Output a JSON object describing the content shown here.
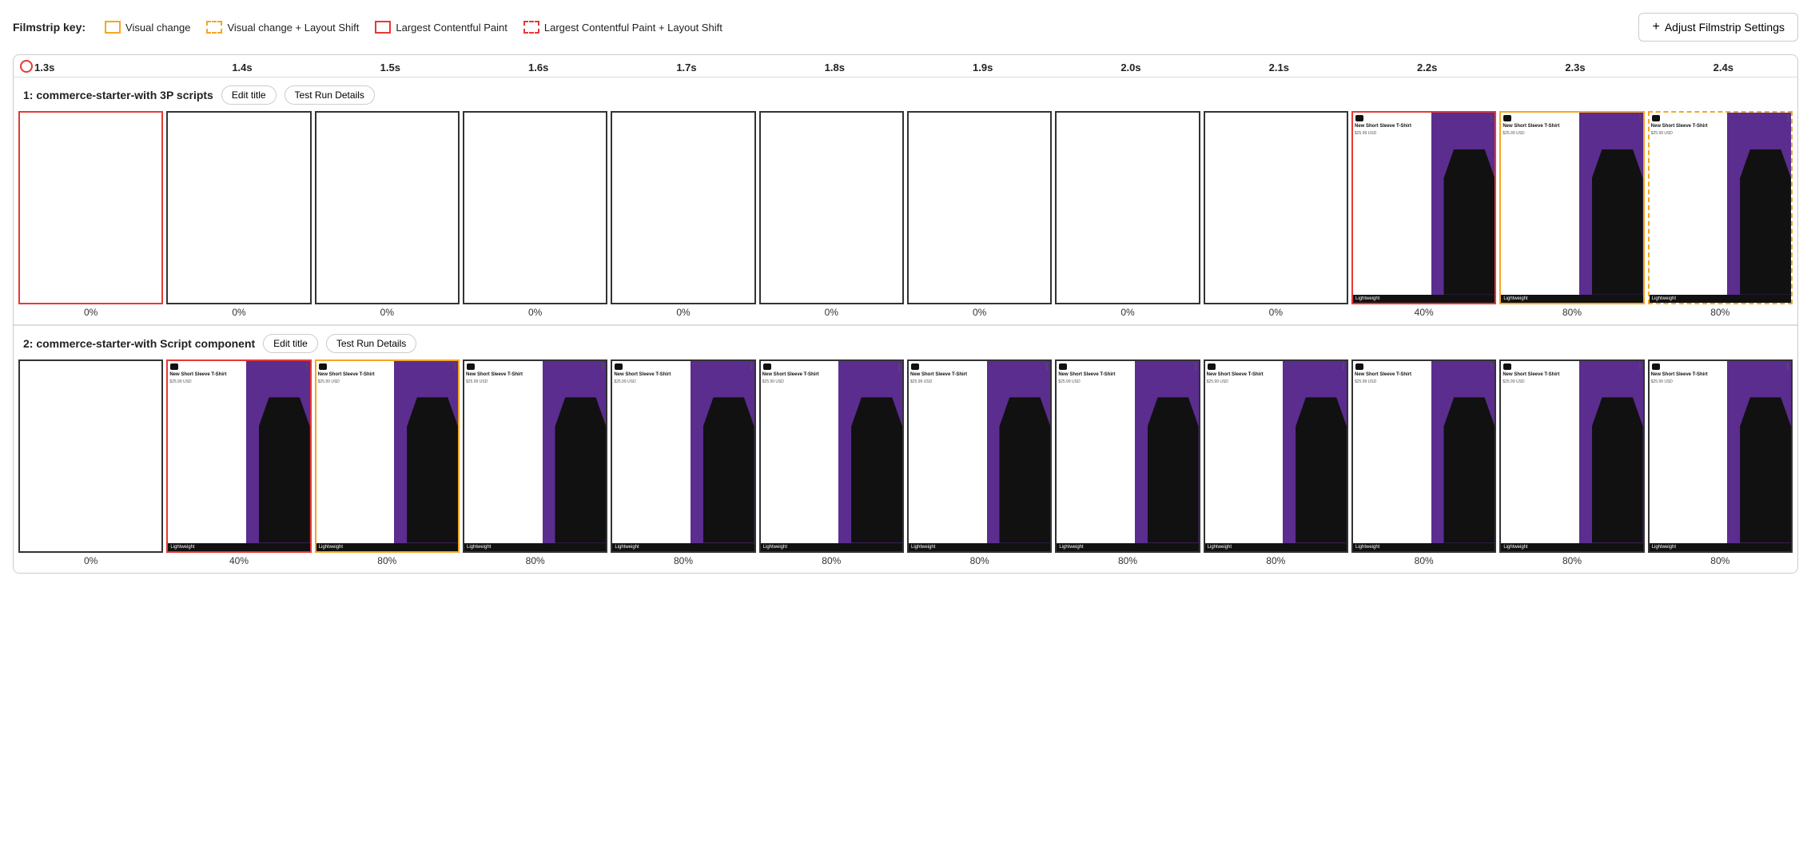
{
  "legend": {
    "label": "Filmstrip key:",
    "items": [
      {
        "id": "visual-change",
        "box_style": "solid-yellow",
        "label": "Visual change"
      },
      {
        "id": "visual-change-layout-shift",
        "box_style": "dashed-yellow",
        "label": "Visual change + Layout Shift"
      },
      {
        "id": "lcp",
        "box_style": "solid-red",
        "label": "Largest Contentful Paint"
      },
      {
        "id": "lcp-layout-shift",
        "box_style": "dashed-red",
        "label": "Largest Contentful Paint + Layout Shift"
      }
    ]
  },
  "adjust_button": {
    "label": "Adjust Filmstrip Settings",
    "icon": "+"
  },
  "timeline_ticks": [
    "1.3s",
    "1.4s",
    "1.5s",
    "1.6s",
    "1.7s",
    "1.8s",
    "1.9s",
    "2.0s",
    "2.1s",
    "2.2s",
    "2.3s",
    "2.4s"
  ],
  "rows": [
    {
      "id": "row1",
      "title": "1: commerce-starter-with 3P scripts",
      "edit_title_label": "Edit title",
      "test_run_details_label": "Test Run Details",
      "frames": [
        {
          "border": "red-solid",
          "has_content": false,
          "percent": "0%"
        },
        {
          "border": "grey-solid",
          "has_content": false,
          "percent": "0%"
        },
        {
          "border": "grey-solid",
          "has_content": false,
          "percent": "0%"
        },
        {
          "border": "grey-solid",
          "has_content": false,
          "percent": "0%"
        },
        {
          "border": "grey-solid",
          "has_content": false,
          "percent": "0%"
        },
        {
          "border": "grey-solid",
          "has_content": false,
          "percent": "0%"
        },
        {
          "border": "grey-solid",
          "has_content": false,
          "percent": "0%"
        },
        {
          "border": "grey-solid",
          "has_content": false,
          "percent": "0%"
        },
        {
          "border": "grey-solid",
          "has_content": false,
          "percent": "0%"
        },
        {
          "border": "red-solid",
          "has_content": true,
          "percent": "40%"
        },
        {
          "border": "yellow-solid",
          "has_content": true,
          "percent": "80%"
        },
        {
          "border": "yellow-dashed",
          "has_content": true,
          "percent": "80%"
        }
      ]
    },
    {
      "id": "row2",
      "title": "2: commerce-starter-with Script component",
      "edit_title_label": "Edit title",
      "test_run_details_label": "Test Run Details",
      "frames": [
        {
          "border": "grey-solid",
          "has_content": false,
          "percent": "0%"
        },
        {
          "border": "red-solid",
          "has_content": true,
          "percent": "40%"
        },
        {
          "border": "yellow-solid",
          "has_content": true,
          "percent": "80%"
        },
        {
          "border": "grey-solid",
          "has_content": true,
          "percent": "80%"
        },
        {
          "border": "grey-solid",
          "has_content": true,
          "percent": "80%"
        },
        {
          "border": "grey-solid",
          "has_content": true,
          "percent": "80%"
        },
        {
          "border": "grey-solid",
          "has_content": true,
          "percent": "80%"
        },
        {
          "border": "grey-solid",
          "has_content": true,
          "percent": "80%"
        },
        {
          "border": "grey-solid",
          "has_content": true,
          "percent": "80%"
        },
        {
          "border": "grey-solid",
          "has_content": true,
          "percent": "80%"
        },
        {
          "border": "grey-solid",
          "has_content": true,
          "percent": "80%"
        },
        {
          "border": "grey-solid",
          "has_content": true,
          "percent": "80%"
        }
      ]
    }
  ],
  "product": {
    "title": "New Short Sleeve T-Shirt",
    "price": "$25.99 USD",
    "badge": "Lightweight"
  }
}
